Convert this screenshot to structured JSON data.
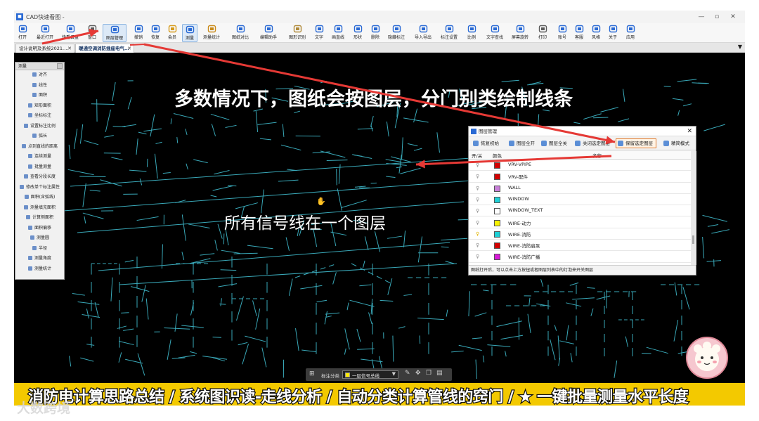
{
  "window": {
    "title": "CAD快速看图 -",
    "controls": [
      "—",
      "▫",
      "✕"
    ]
  },
  "toolbar": {
    "items": [
      {
        "label": "打开",
        "icon": "folder-open-icon"
      },
      {
        "label": "最近打开",
        "icon": "clock-icon"
      },
      {
        "label": "快看云盘",
        "icon": "cloud-icon"
      },
      {
        "label": "窗口",
        "icon": "window-icon"
      },
      {
        "label": "图层管理",
        "icon": "layers-icon"
      },
      {
        "label": "撤销",
        "icon": "undo-icon"
      },
      {
        "label": "恢复",
        "icon": "redo-icon"
      },
      {
        "label": "会员",
        "icon": "vip-icon"
      },
      {
        "label": "测量",
        "icon": "ruler-icon"
      },
      {
        "label": "测量统计",
        "icon": "stats-icon"
      },
      {
        "label": "图纸对比",
        "icon": "compare-icon"
      },
      {
        "label": "编辑助手",
        "icon": "edit-icon"
      },
      {
        "label": "图形识别",
        "icon": "shape-recognize-icon"
      },
      {
        "label": "文字",
        "icon": "text-icon"
      },
      {
        "label": "画直线",
        "icon": "line-icon"
      },
      {
        "label": "形状",
        "icon": "shape-icon"
      },
      {
        "label": "删除",
        "icon": "eraser-icon"
      },
      {
        "label": "隐藏标注",
        "icon": "eye-icon"
      },
      {
        "label": "导入导出",
        "icon": "import-export-icon"
      },
      {
        "label": "标注设置",
        "icon": "annotation-settings-icon"
      },
      {
        "label": "比例",
        "icon": "scale-icon"
      },
      {
        "label": "文字查找",
        "icon": "search-text-icon"
      },
      {
        "label": "屏幕旋转",
        "icon": "rotate-icon"
      },
      {
        "label": "打印",
        "icon": "printer-icon"
      },
      {
        "label": "账号",
        "icon": "user-icon"
      },
      {
        "label": "客服",
        "icon": "headset-icon"
      },
      {
        "label": "风格",
        "icon": "style-icon"
      },
      {
        "label": "关于",
        "icon": "info-icon"
      },
      {
        "label": "应用",
        "icon": "apps-icon"
      }
    ]
  },
  "tabs": [
    {
      "label": "设计说明及系统2021.…",
      "close": "✕"
    },
    {
      "label": "暖通空调消防插座电气…",
      "close": "✕"
    }
  ],
  "tab_dropdown": "▼",
  "measure_panel": {
    "title": "测量",
    "items": [
      "对齐",
      "线性",
      "面积",
      "矩形面积",
      "坐标标注",
      "设置标注比例",
      "弧长",
      "点到直线的距离",
      "连续测量",
      "批量测量",
      "查看分段长度",
      "修改单个标注属性",
      "面积(含弧线)",
      "测量填充面积",
      "计算侧面积",
      "面积偏移",
      "测量圆",
      "半径",
      "测量角度",
      "测量统计"
    ]
  },
  "captions": {
    "top": "多数情况下，图纸会按图层，分门别类绘制线条",
    "middle": "所有信号线在一个图层"
  },
  "layer_dialog": {
    "title": "图层管理",
    "close": "✕",
    "buttons": [
      "恢复初始",
      "图层全开",
      "图层全关",
      "关闭选定图层",
      "保留选定图层",
      "精简模式"
    ],
    "columns": {
      "toggle": "开/关",
      "color": "颜色",
      "name": "名称"
    },
    "layers": [
      {
        "name": "VRV-VPIPE",
        "color": "#d40000",
        "on": true
      },
      {
        "name": "VRV-配件",
        "color": "#d40000",
        "on": true
      },
      {
        "name": "WALL",
        "color": "#c87fd8",
        "on": true
      },
      {
        "name": "WINDOW",
        "color": "#1fd0d6",
        "on": true
      },
      {
        "name": "WINDOW_TEXT",
        "color": "#ffffff",
        "on": true
      },
      {
        "name": "WIRE-动力",
        "color": "#f6f200",
        "on": true
      },
      {
        "name": "WIRE-消防",
        "color": "#1fd0d6",
        "on": true
      },
      {
        "name": "WIRE-消防启泵",
        "color": "#d40000",
        "on": true
      },
      {
        "name": "WIRE-消防广播",
        "color": "#d81ad8",
        "on": true
      }
    ],
    "footer": "图纸打开后，可以点击上方按钮或者图层列表中的灯泡来开关图层"
  },
  "bottom_bar": {
    "label": "标注分类",
    "value": "一层信号总线",
    "value_color": "#ffea00"
  },
  "banner": {
    "text": "消防电计算思路总结 / 系统图识读-走线分析 / 自动分类计算管线的窍门 / ★ 一键批量测量水平长度"
  },
  "watermark": "大数跨境",
  "colors": {
    "cad_lines": "#39a8b8",
    "arrow": "#e53935",
    "banner": "#f3c900",
    "highlight": "#e07a2c"
  }
}
